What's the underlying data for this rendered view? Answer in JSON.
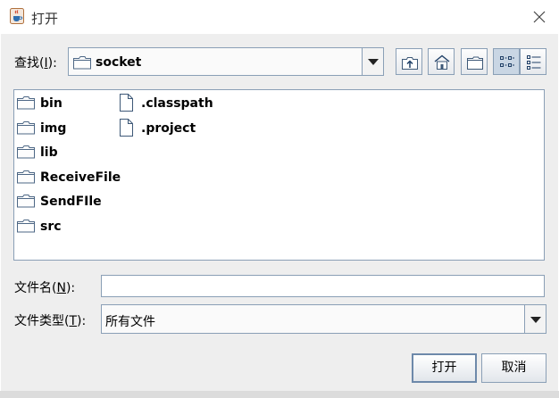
{
  "window": {
    "title": "打开",
    "app_icon": "java-cup-icon",
    "close_icon": "close-icon"
  },
  "look_in": {
    "label": "查找(",
    "mnemonic": "I",
    "label_end": "):",
    "value": "socket"
  },
  "toolbar": [
    {
      "name": "up-one-level-button",
      "icon": "folder-up-icon"
    },
    {
      "name": "home-button",
      "icon": "home-icon"
    },
    {
      "name": "new-folder-button",
      "icon": "new-folder-icon"
    },
    {
      "name": "list-view-button",
      "icon": "list-view-icon",
      "selected": true
    },
    {
      "name": "details-view-button",
      "icon": "details-view-icon",
      "selected": false
    }
  ],
  "files": [
    {
      "name": "bin",
      "type": "folder"
    },
    {
      "name": "img",
      "type": "folder"
    },
    {
      "name": "lib",
      "type": "folder"
    },
    {
      "name": "ReceiveFile",
      "type": "folder"
    },
    {
      "name": "SendFIle",
      "type": "folder"
    },
    {
      "name": "src",
      "type": "folder"
    },
    {
      "name": ".classpath",
      "type": "file"
    },
    {
      "name": ".project",
      "type": "file"
    }
  ],
  "file_name": {
    "label": "文件名(",
    "mnemonic": "N",
    "label_end": "):",
    "value": ""
  },
  "file_type": {
    "label": "文件类型(",
    "mnemonic": "T",
    "label_end": "):",
    "value": "所有文件"
  },
  "buttons": {
    "open": "打开",
    "cancel": "取消"
  },
  "colors": {
    "border": "#8a9fb6",
    "panel": "#eeeeee",
    "selected_toggle": "#c9d6e4"
  }
}
